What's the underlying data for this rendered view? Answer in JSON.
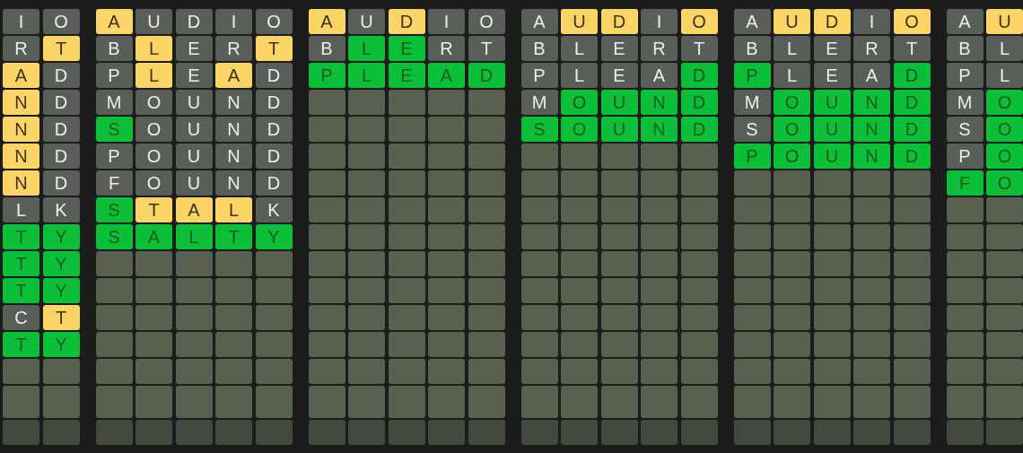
{
  "boards": [
    {
      "guesses": [
        [
          {
            "letter": "I",
            "color": "#5a5e58"
          },
          {
            "letter": "O",
            "color": "#5a5e58"
          }
        ],
        [
          {
            "letter": "R",
            "color": "#5a5e58"
          },
          {
            "letter": "T",
            "color": "#fbd466"
          }
        ],
        [
          {
            "letter": "A",
            "color": "#fbd466"
          },
          {
            "letter": "D",
            "color": "#5a5e58"
          }
        ],
        [
          {
            "letter": "N",
            "color": "#fbd466"
          },
          {
            "letter": "D",
            "color": "#5a5e58"
          }
        ],
        [
          {
            "letter": "N",
            "color": "#fbd466"
          },
          {
            "letter": "D",
            "color": "#5a5e58"
          }
        ],
        [
          {
            "letter": "N",
            "color": "#fbd466"
          },
          {
            "letter": "D",
            "color": "#5a5e58"
          }
        ],
        [
          {
            "letter": "N",
            "color": "#fbd466"
          },
          {
            "letter": "D",
            "color": "#5a5e58"
          }
        ],
        [
          {
            "letter": "L",
            "color": "#5a5e58"
          },
          {
            "letter": "K",
            "color": "#5a5e58"
          }
        ],
        [
          {
            "letter": "T",
            "color": "#0bbf39"
          },
          {
            "letter": "Y",
            "color": "#0bbf39"
          }
        ],
        [
          {
            "letter": "T",
            "color": "#0bbf39"
          },
          {
            "letter": "Y",
            "color": "#0bbf39"
          }
        ],
        [
          {
            "letter": "T",
            "color": "#0bbf39"
          },
          {
            "letter": "Y",
            "color": "#0bbf39"
          }
        ],
        [
          {
            "letter": "C",
            "color": "#5a5e58"
          },
          {
            "letter": "T",
            "color": "#fbd466"
          }
        ],
        [
          {
            "letter": "T",
            "color": "#0bbf39"
          },
          {
            "letter": "Y",
            "color": "#0bbf39"
          }
        ]
      ]
    },
    {
      "guesses": [
        [
          {
            "letter": "A",
            "color": "#fbd466"
          },
          {
            "letter": "U",
            "color": "#5a5e58"
          },
          {
            "letter": "D",
            "color": "#5a5e58"
          },
          {
            "letter": "I",
            "color": "#5a5e58"
          },
          {
            "letter": "O",
            "color": "#5a5e58"
          }
        ],
        [
          {
            "letter": "B",
            "color": "#5a5e58"
          },
          {
            "letter": "L",
            "color": "#fbd466"
          },
          {
            "letter": "E",
            "color": "#5a5e58"
          },
          {
            "letter": "R",
            "color": "#5a5e58"
          },
          {
            "letter": "T",
            "color": "#fbd466"
          }
        ],
        [
          {
            "letter": "P",
            "color": "#5a5e58"
          },
          {
            "letter": "L",
            "color": "#fbd466"
          },
          {
            "letter": "E",
            "color": "#5a5e58"
          },
          {
            "letter": "A",
            "color": "#fbd466"
          },
          {
            "letter": "D",
            "color": "#5a5e58"
          }
        ],
        [
          {
            "letter": "M",
            "color": "#5a5e58"
          },
          {
            "letter": "O",
            "color": "#5a5e58"
          },
          {
            "letter": "U",
            "color": "#5a5e58"
          },
          {
            "letter": "N",
            "color": "#5a5e58"
          },
          {
            "letter": "D",
            "color": "#5a5e58"
          }
        ],
        [
          {
            "letter": "S",
            "color": "#0bbf39"
          },
          {
            "letter": "O",
            "color": "#5a5e58"
          },
          {
            "letter": "U",
            "color": "#5a5e58"
          },
          {
            "letter": "N",
            "color": "#5a5e58"
          },
          {
            "letter": "D",
            "color": "#5a5e58"
          }
        ],
        [
          {
            "letter": "P",
            "color": "#5a5e58"
          },
          {
            "letter": "O",
            "color": "#5a5e58"
          },
          {
            "letter": "U",
            "color": "#5a5e58"
          },
          {
            "letter": "N",
            "color": "#5a5e58"
          },
          {
            "letter": "D",
            "color": "#5a5e58"
          }
        ],
        [
          {
            "letter": "F",
            "color": "#5a5e58"
          },
          {
            "letter": "O",
            "color": "#5a5e58"
          },
          {
            "letter": "U",
            "color": "#5a5e58"
          },
          {
            "letter": "N",
            "color": "#5a5e58"
          },
          {
            "letter": "D",
            "color": "#5a5e58"
          }
        ],
        [
          {
            "letter": "S",
            "color": "#0bbf39"
          },
          {
            "letter": "T",
            "color": "#fbd466"
          },
          {
            "letter": "A",
            "color": "#fbd466"
          },
          {
            "letter": "L",
            "color": "#fbd466"
          },
          {
            "letter": "K",
            "color": "#5a5e58"
          }
        ],
        [
          {
            "letter": "S",
            "color": "#0bbf39"
          },
          {
            "letter": "A",
            "color": "#0bbf39"
          },
          {
            "letter": "L",
            "color": "#0bbf39"
          },
          {
            "letter": "T",
            "color": "#0bbf39"
          },
          {
            "letter": "Y",
            "color": "#0bbf39"
          }
        ]
      ]
    },
    {
      "guesses": [
        [
          {
            "letter": "A",
            "color": "#fbd466"
          },
          {
            "letter": "U",
            "color": "#5a5e58"
          },
          {
            "letter": "D",
            "color": "#fbd466"
          },
          {
            "letter": "I",
            "color": "#5a5e58"
          },
          {
            "letter": "O",
            "color": "#5a5e58"
          }
        ],
        [
          {
            "letter": "B",
            "color": "#5a5e58"
          },
          {
            "letter": "L",
            "color": "#0bbf39"
          },
          {
            "letter": "E",
            "color": "#0bbf39"
          },
          {
            "letter": "R",
            "color": "#5a5e58"
          },
          {
            "letter": "T",
            "color": "#5a5e58"
          }
        ],
        [
          {
            "letter": "P",
            "color": "#0bbf39"
          },
          {
            "letter": "L",
            "color": "#0bbf39"
          },
          {
            "letter": "E",
            "color": "#0bbf39"
          },
          {
            "letter": "A",
            "color": "#0bbf39"
          },
          {
            "letter": "D",
            "color": "#0bbf39"
          }
        ]
      ]
    },
    {
      "guesses": [
        [
          {
            "letter": "A",
            "color": "#5a5e58"
          },
          {
            "letter": "U",
            "color": "#fbd466"
          },
          {
            "letter": "D",
            "color": "#fbd466"
          },
          {
            "letter": "I",
            "color": "#5a5e58"
          },
          {
            "letter": "O",
            "color": "#fbd466"
          }
        ],
        [
          {
            "letter": "B",
            "color": "#5a5e58"
          },
          {
            "letter": "L",
            "color": "#5a5e58"
          },
          {
            "letter": "E",
            "color": "#5a5e58"
          },
          {
            "letter": "R",
            "color": "#5a5e58"
          },
          {
            "letter": "T",
            "color": "#5a5e58"
          }
        ],
        [
          {
            "letter": "P",
            "color": "#5a5e58"
          },
          {
            "letter": "L",
            "color": "#5a5e58"
          },
          {
            "letter": "E",
            "color": "#5a5e58"
          },
          {
            "letter": "A",
            "color": "#5a5e58"
          },
          {
            "letter": "D",
            "color": "#0bbf39"
          }
        ],
        [
          {
            "letter": "M",
            "color": "#5a5e58"
          },
          {
            "letter": "O",
            "color": "#0bbf39"
          },
          {
            "letter": "U",
            "color": "#0bbf39"
          },
          {
            "letter": "N",
            "color": "#0bbf39"
          },
          {
            "letter": "D",
            "color": "#0bbf39"
          }
        ],
        [
          {
            "letter": "S",
            "color": "#0bbf39"
          },
          {
            "letter": "O",
            "color": "#0bbf39"
          },
          {
            "letter": "U",
            "color": "#0bbf39"
          },
          {
            "letter": "N",
            "color": "#0bbf39"
          },
          {
            "letter": "D",
            "color": "#0bbf39"
          }
        ]
      ]
    },
    {
      "guesses": [
        [
          {
            "letter": "A",
            "color": "#5a5e58"
          },
          {
            "letter": "U",
            "color": "#fbd466"
          },
          {
            "letter": "D",
            "color": "#fbd466"
          },
          {
            "letter": "I",
            "color": "#5a5e58"
          },
          {
            "letter": "O",
            "color": "#fbd466"
          }
        ],
        [
          {
            "letter": "B",
            "color": "#5a5e58"
          },
          {
            "letter": "L",
            "color": "#5a5e58"
          },
          {
            "letter": "E",
            "color": "#5a5e58"
          },
          {
            "letter": "R",
            "color": "#5a5e58"
          },
          {
            "letter": "T",
            "color": "#5a5e58"
          }
        ],
        [
          {
            "letter": "P",
            "color": "#0bbf39"
          },
          {
            "letter": "L",
            "color": "#5a5e58"
          },
          {
            "letter": "E",
            "color": "#5a5e58"
          },
          {
            "letter": "A",
            "color": "#5a5e58"
          },
          {
            "letter": "D",
            "color": "#0bbf39"
          }
        ],
        [
          {
            "letter": "M",
            "color": "#5a5e58"
          },
          {
            "letter": "O",
            "color": "#0bbf39"
          },
          {
            "letter": "U",
            "color": "#0bbf39"
          },
          {
            "letter": "N",
            "color": "#0bbf39"
          },
          {
            "letter": "D",
            "color": "#0bbf39"
          }
        ],
        [
          {
            "letter": "S",
            "color": "#5a5e58"
          },
          {
            "letter": "O",
            "color": "#0bbf39"
          },
          {
            "letter": "U",
            "color": "#0bbf39"
          },
          {
            "letter": "N",
            "color": "#0bbf39"
          },
          {
            "letter": "D",
            "color": "#0bbf39"
          }
        ],
        [
          {
            "letter": "P",
            "color": "#0bbf39"
          },
          {
            "letter": "O",
            "color": "#0bbf39"
          },
          {
            "letter": "U",
            "color": "#0bbf39"
          },
          {
            "letter": "N",
            "color": "#0bbf39"
          },
          {
            "letter": "D",
            "color": "#0bbf39"
          }
        ]
      ]
    },
    {
      "guesses": [
        [
          {
            "letter": "A",
            "color": "#5a5e58"
          },
          {
            "letter": "U",
            "color": "#fbd466"
          }
        ],
        [
          {
            "letter": "B",
            "color": "#5a5e58"
          },
          {
            "letter": "L",
            "color": "#5a5e58"
          }
        ],
        [
          {
            "letter": "P",
            "color": "#5a5e58"
          },
          {
            "letter": "L",
            "color": "#5a5e58"
          }
        ],
        [
          {
            "letter": "M",
            "color": "#5a5e58"
          },
          {
            "letter": "O",
            "color": "#0bbf39"
          }
        ],
        [
          {
            "letter": "S",
            "color": "#5a5e58"
          },
          {
            "letter": "O",
            "color": "#0bbf39"
          }
        ],
        [
          {
            "letter": "P",
            "color": "#5a5e58"
          },
          {
            "letter": "O",
            "color": "#0bbf39"
          }
        ],
        [
          {
            "letter": "F",
            "color": "#0bbf39"
          },
          {
            "letter": "O",
            "color": "#0bbf39"
          }
        ]
      ]
    }
  ]
}
